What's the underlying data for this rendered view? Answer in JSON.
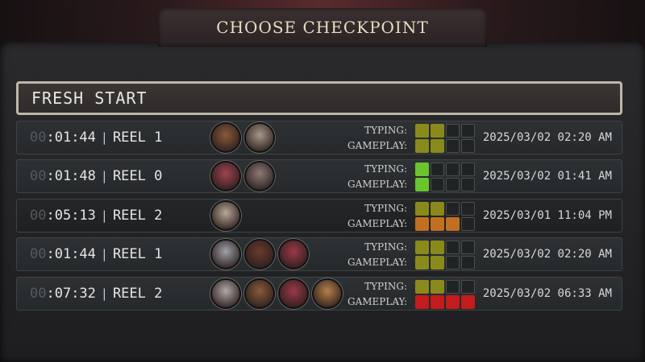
{
  "header": {
    "title": "CHOOSE CHECKPOINT"
  },
  "fresh_start": {
    "label": "FRESH START"
  },
  "checkpoints": [
    {
      "time_dim": "00",
      "time_main": ":01:44",
      "separator": "|",
      "reel": "REEL 1",
      "typing_label": "TYPING:",
      "gameplay_label": "GAMEPLAY:",
      "typing_level": 2,
      "gameplay_level": 2,
      "typing_color": "#8a8a1c",
      "gameplay_color": "#8a8a1c",
      "avatars": [
        "#8a5a3c",
        "#a89888"
      ],
      "timestamp": "2025/03/02 02:20 AM"
    },
    {
      "time_dim": "00",
      "time_main": ":01:48",
      "separator": "|",
      "reel": "REEL 0",
      "typing_label": "TYPING:",
      "gameplay_label": "GAMEPLAY:",
      "typing_level": 1,
      "gameplay_level": 1,
      "typing_color": "#6ac42e",
      "gameplay_color": "#6ac42e",
      "avatars": [
        "#a04450",
        "#8c7a76"
      ],
      "timestamp": "2025/03/02 01:41 AM"
    },
    {
      "time_dim": "00",
      "time_main": ":05:13",
      "separator": "|",
      "reel": "REEL 2",
      "typing_label": "TYPING:",
      "gameplay_label": "GAMEPLAY:",
      "typing_level": 2,
      "gameplay_level": 3,
      "typing_color": "#8a8a1c",
      "gameplay_color": "#c07020",
      "avatars": [
        "#b8a898"
      ],
      "timestamp": "2025/03/01 11:04 PM"
    },
    {
      "time_dim": "00",
      "time_main": ":01:44",
      "separator": "|",
      "reel": "REEL 1",
      "typing_label": "TYPING:",
      "gameplay_label": "GAMEPLAY:",
      "typing_level": 2,
      "gameplay_level": 2,
      "typing_color": "#8a8a1c",
      "gameplay_color": "#8a8a1c",
      "avatars": [
        "#a0a0a8",
        "#6a3a2e",
        "#9c3a48"
      ],
      "timestamp": "2025/03/02 02:20 AM"
    },
    {
      "time_dim": "00",
      "time_main": ":07:32",
      "separator": "|",
      "reel": "REEL 2",
      "typing_label": "TYPING:",
      "gameplay_label": "GAMEPLAY:",
      "typing_level": 2,
      "gameplay_level": 4,
      "typing_color": "#8a8a1c",
      "gameplay_color": "#c41c1c",
      "avatars": [
        "#b0a8a8",
        "#8a5a3c",
        "#9c3a48",
        "#b8804c"
      ],
      "timestamp": "2025/03/02 06:33 AM"
    }
  ]
}
